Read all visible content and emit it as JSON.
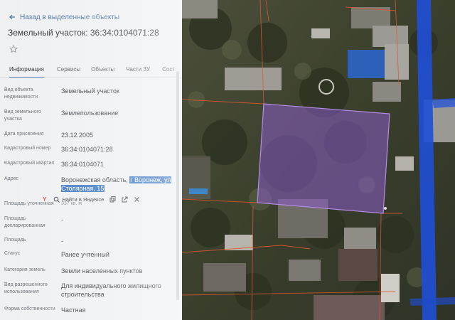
{
  "panel": {
    "back_link": "Назад в выделенные объекты",
    "title": "Земельный участок: 36:34:0104071:28",
    "tabs": [
      {
        "label": "Информация",
        "active": true
      },
      {
        "label": "Сервисы",
        "active": false
      },
      {
        "label": "Объекты",
        "active": false
      },
      {
        "label": "Части ЗУ",
        "active": false
      },
      {
        "label": "Сост",
        "active": false
      }
    ],
    "rows": [
      {
        "label": "Вид объекта недвижимости",
        "value": "Земельный участок"
      },
      {
        "label": "Вид земельного участка",
        "value": "Землепользование"
      },
      {
        "label": "Дата присвоения",
        "value": "23.12.2005"
      },
      {
        "label": "Кадастровый номер",
        "value": "36:34:0104071:28"
      },
      {
        "label": "Кадастровый квартал",
        "value": "36:34:0104071"
      },
      {
        "label": "Адрес",
        "value_prefix": "Воронежская область, ",
        "value_highlight": "г Воронеж, ул Столярная, 15"
      },
      {
        "label": "Площадь уточненная",
        "value": "337 кв. м"
      },
      {
        "label": "Площадь декларированная",
        "value": "-"
      },
      {
        "label": "Площадь",
        "value": "-"
      },
      {
        "label": "Статус",
        "value": "Ранее учтенный"
      },
      {
        "label": "Категория земель",
        "value": "Земли населенных пунктов"
      },
      {
        "label": "Вид разрешенного использования",
        "value": "Для индивидуального жилищного строительства"
      },
      {
        "label": "Форма собственности",
        "value": "Частная"
      }
    ],
    "popup": {
      "yandex_letter": "Y",
      "find_label": "Найти в Яндексе"
    }
  },
  "colors": {
    "accent": "#5b86c7",
    "highlight": "#3e78c4",
    "parcel_fill": "#8a5cc9",
    "boundary": "#e0582e",
    "road": "#1f4fd8"
  }
}
